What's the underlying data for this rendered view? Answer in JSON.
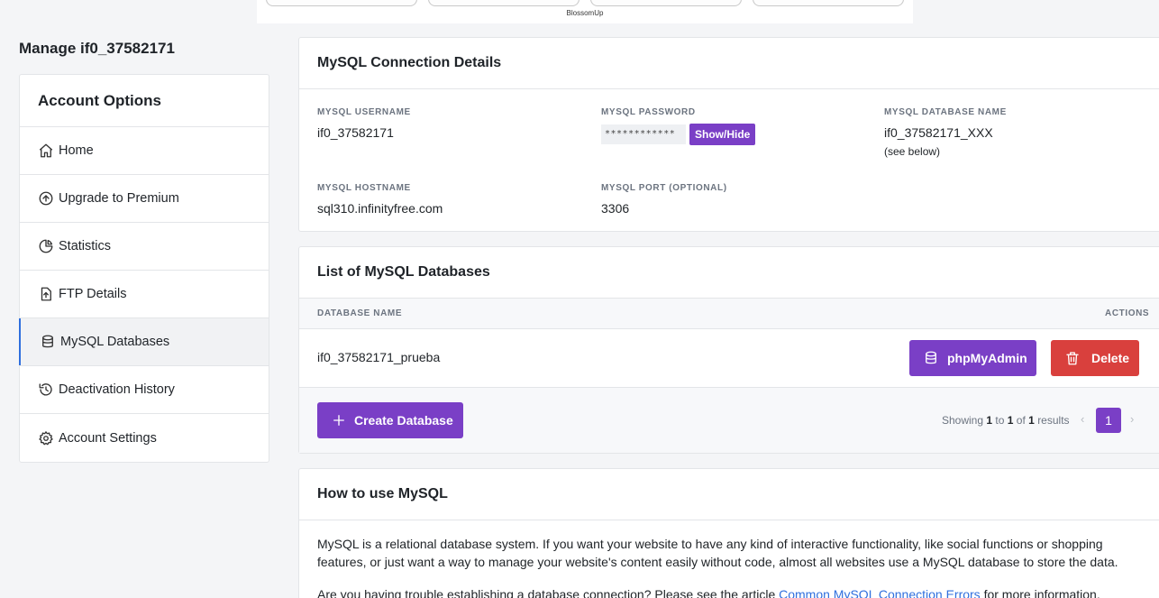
{
  "ad": {
    "label": "BlossomUp"
  },
  "account": {
    "title": "Manage if0_37582171"
  },
  "sidebar": {
    "header": "Account Options",
    "items": [
      {
        "label": "Home",
        "icon": "home-icon"
      },
      {
        "label": "Upgrade to Premium",
        "icon": "arrow-up-circle-icon"
      },
      {
        "label": "Statistics",
        "icon": "pie-chart-icon"
      },
      {
        "label": "FTP Details",
        "icon": "file-upload-icon"
      },
      {
        "label": "MySQL Databases",
        "icon": "database-icon",
        "active": true
      },
      {
        "label": "Deactivation History",
        "icon": "history-icon"
      },
      {
        "label": "Account Settings",
        "icon": "gear-icon"
      }
    ]
  },
  "connection": {
    "title": "MySQL Connection Details",
    "username_label": "MySQL Username",
    "username": "if0_37582171",
    "password_label": "MySQL Password",
    "password_mask": "************",
    "showhide_label": "Show/Hide",
    "dbname_label": "MySQL Database Name",
    "dbname": "if0_37582171_XXX",
    "dbname_note": "(see below)",
    "hostname_label": "MySQL Hostname",
    "hostname": "sql310.infinityfree.com",
    "port_label": "MySQL Port (Optional)",
    "port": "3306"
  },
  "databases": {
    "title": "List of MySQL Databases",
    "col_name": "Database Name",
    "col_actions": "Actions",
    "rows": [
      {
        "name": "if0_37582171_prueba",
        "pma_label": "phpMyAdmin",
        "delete_label": "Delete"
      }
    ],
    "create_label": "Create Database",
    "pager": {
      "prefix": "Showing",
      "from": "1",
      "to_word": "to",
      "to": "1",
      "of_word": "of",
      "total": "1",
      "suffix": "results",
      "page": "1"
    }
  },
  "howto": {
    "title": "How to use MySQL",
    "para1": "MySQL is a relational database system. If you want your website to have any kind of interactive functionality, like social functions or shopping features, or just want a way to manage your website's content easily without code, almost all websites use a MySQL database to store the data.",
    "para2_start": "Are you having trouble establishing a database connection? Please see the article ",
    "para2_link": "Common MySQL Connection Errors",
    "para2_end": " for more information."
  },
  "colors": {
    "accent": "#7a3fc6",
    "danger": "#d9403d",
    "active_bar": "#2f6fde",
    "link": "#2f6fde"
  }
}
